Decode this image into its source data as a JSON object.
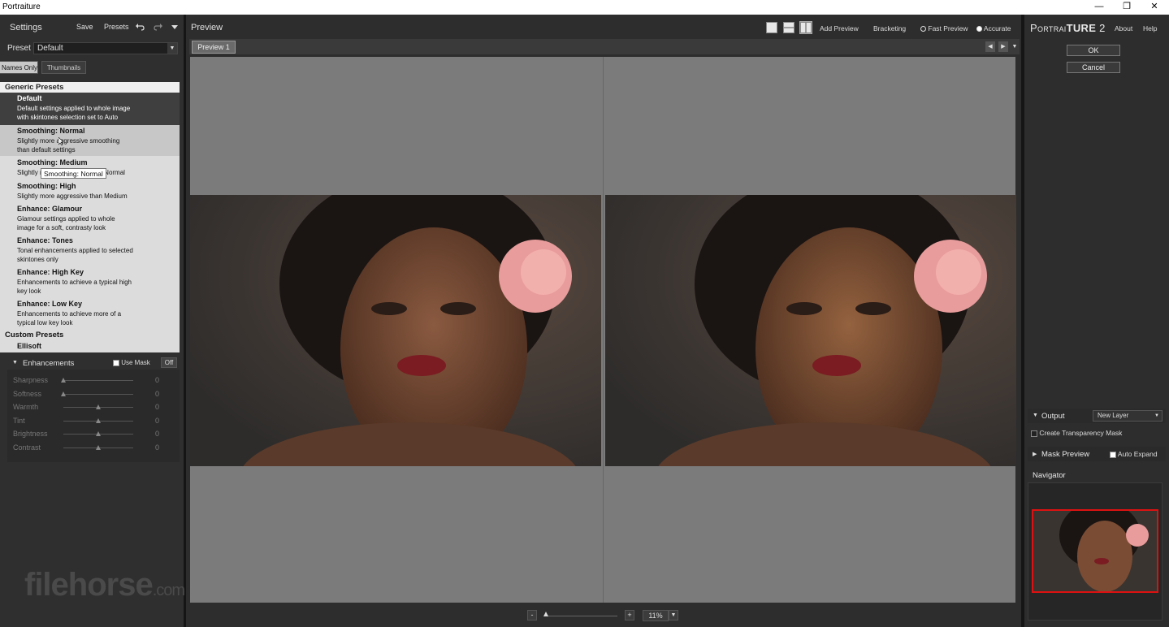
{
  "titlebar": {
    "title": "Portraiture",
    "minimize": "—",
    "maximize": "❐",
    "close": "✕"
  },
  "left": {
    "title": "Settings",
    "save": "Save",
    "presets": "Presets",
    "preset_label": "Preset",
    "preset_value": "Default",
    "names_only": "Names Only",
    "thumbnails": "Thumbnails",
    "generic_header": "Generic Presets",
    "custom_header": "Custom Presets",
    "custom_item": "Ellisoft",
    "tooltip": "Smoothing: Normal",
    "items": [
      {
        "name": "Default",
        "desc": "Default settings applied to whole image\nwith skintones selection set to Auto"
      },
      {
        "name": "Smoothing: Normal",
        "desc": "Slightly more aggressive smoothing\nthan default settings"
      },
      {
        "name": "Smoothing: Medium",
        "desc": "Slightly more aggressive than Normal"
      },
      {
        "name": "Smoothing: High",
        "desc": "Slightly more aggressive than Medium"
      },
      {
        "name": "Enhance: Glamour",
        "desc": "Glamour settings applied to whole\nimage for a soft, contrasty look"
      },
      {
        "name": "Enhance: Tones",
        "desc": "Tonal enhancements applied to selected\nskintones only"
      },
      {
        "name": "Enhance: High Key",
        "desc": "Enhancements to achieve a typical high\nkey look"
      },
      {
        "name": "Enhance: Low Key",
        "desc": "Enhancements to achieve more of a\ntypical low key look"
      }
    ],
    "enhancements": {
      "title": "Enhancements",
      "use_mask": "Use Mask",
      "off": "Off",
      "sliders": [
        {
          "label": "Sharpness",
          "value": "0",
          "level": 0.0
        },
        {
          "label": "Softness",
          "value": "0",
          "level": 0.0
        },
        {
          "label": "Warmth",
          "value": "0",
          "level": 0.5
        },
        {
          "label": "Tint",
          "value": "0",
          "level": 0.5
        },
        {
          "label": "Brightness",
          "value": "0",
          "level": 0.5
        },
        {
          "label": "Contrast",
          "value": "0",
          "level": 0.5
        }
      ]
    },
    "watermark": "filehorse",
    "watermark_suffix": ".com"
  },
  "center": {
    "title": "Preview",
    "add_preview": "Add Preview",
    "bracketing": "Bracketing",
    "fast_preview": "Fast Preview",
    "accurate": "Accurate",
    "tab": "Preview 1",
    "zoom_minus": "-",
    "zoom_plus": "+",
    "zoom_value": "11%"
  },
  "right": {
    "brand_prefix": "Portrai",
    "brand_mid": "ture",
    "brand_suffix": " 2",
    "about": "About",
    "help": "Help",
    "ok": "OK",
    "cancel": "Cancel",
    "output_title": "Output",
    "output_value": "New Layer",
    "transparency_mask": "Create Transparency Mask",
    "mask_preview": "Mask Preview",
    "auto_expand": "Auto Expand",
    "navigator": "Navigator"
  },
  "colors": {
    "accent_red": "#d11111",
    "panel": "#2f2f2f",
    "list_bg": "#dcdcdc"
  }
}
